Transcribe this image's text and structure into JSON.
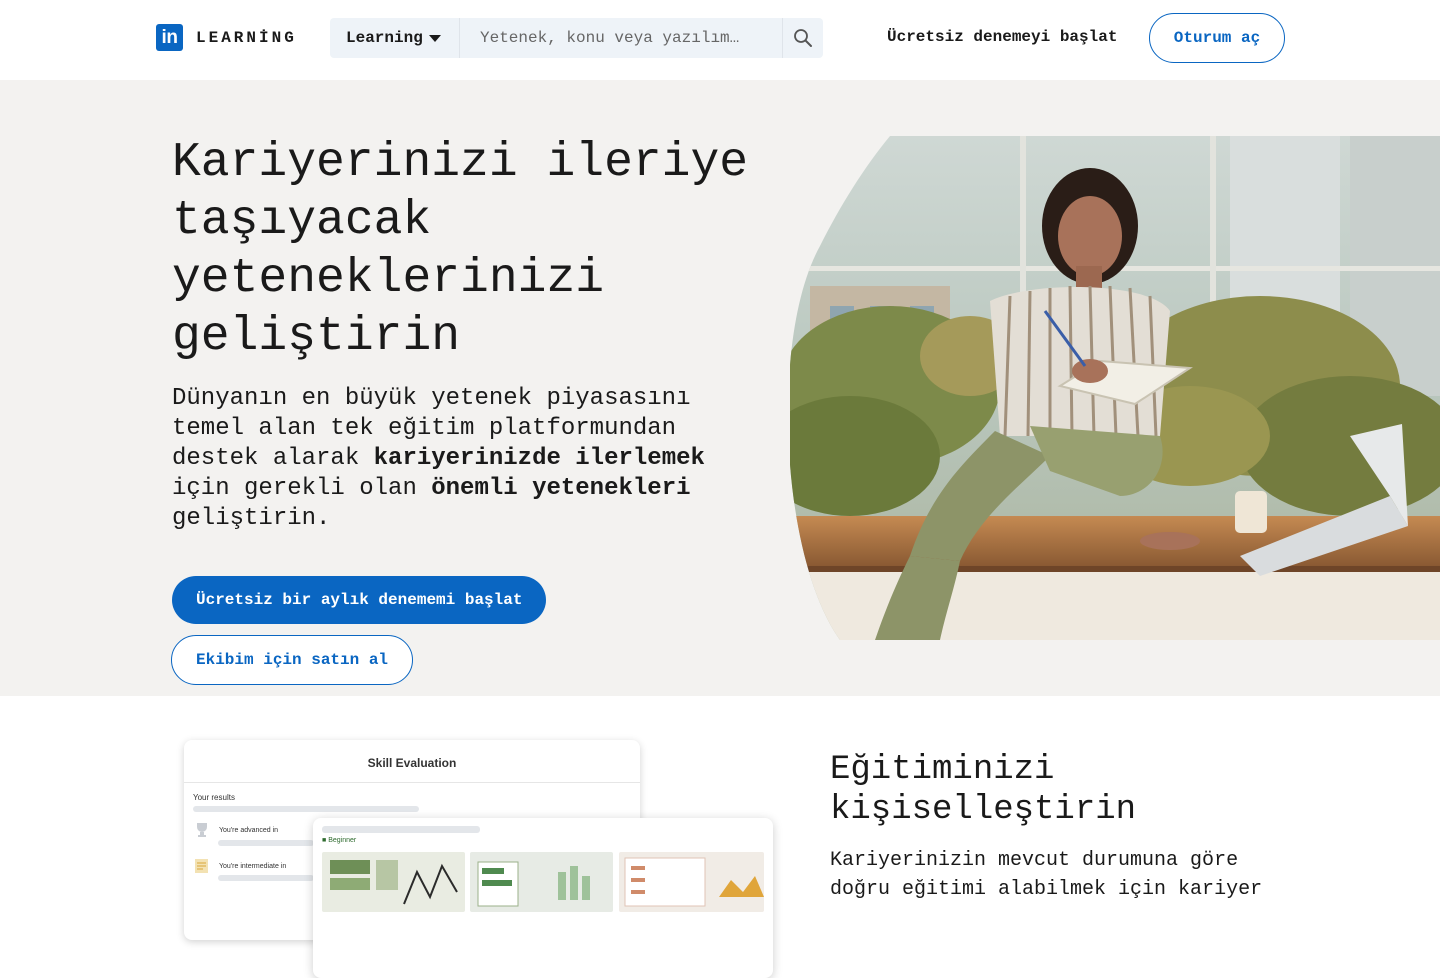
{
  "header": {
    "logo_mark": "in",
    "logo_text": "LEARNİNG",
    "search_category": "Learning",
    "search_placeholder": "Yetenek, konu veya yazılım…",
    "trial_link": "Ücretsiz denemeyi başlat",
    "signin_label": "Oturum aç"
  },
  "hero": {
    "title": "Kariyerinizi ileriye taşıyacak yeteneklerinizi geliştirin",
    "desc_part1": "Dünyanın en büyük yetenek piyasasını temel alan tek eğitim platformundan destek alarak ",
    "desc_bold1": "kariyerinizde ilerlemek",
    "desc_part2": " için gerekli olan ",
    "desc_bold2": "önemli yetenekleri",
    "desc_part3": " geliştirin.",
    "primary_cta": "Ücretsiz bir aylık denememi başlat",
    "secondary_cta": "Ekibim için satın al"
  },
  "mockup": {
    "card_title": "Skill Evaluation",
    "results_label": "Your results",
    "row1": "You're advanced in",
    "row2": "You're intermediate in",
    "level_label": "Beginner"
  },
  "section": {
    "title": "Eğitiminizi kişiselleştirin",
    "desc": "Kariyerinizin mevcut durumuna göre doğru eğitimi alabilmek için kariyer"
  },
  "colors": {
    "brand": "#0a66c2",
    "hero_bg": "#f3f2f0"
  }
}
